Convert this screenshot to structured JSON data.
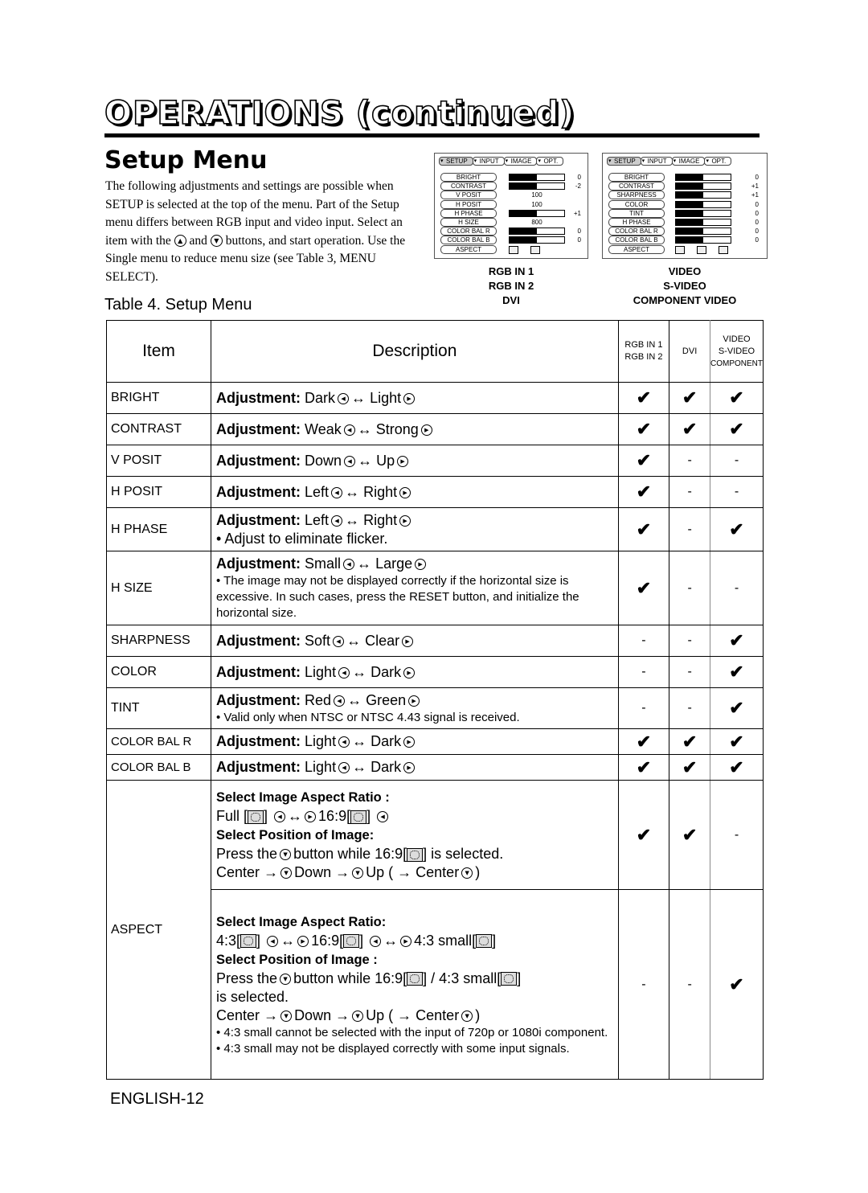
{
  "header": {
    "section_title": "OPERATIONS (continued)",
    "page_title": "Setup Menu",
    "intro_parts": [
      "The following adjustments and settings are possible when SETUP is selected at the top of the menu. Part of the Setup menu differs between RGB input and video input. Select an item with the ",
      " and ",
      " buttons, and start operation. Use the Single menu to reduce menu size (see Table 3, MENU SELECT)."
    ]
  },
  "icons": {
    "up": "▲",
    "down": "▼",
    "left": "◀",
    "right": "▶",
    "swap": "↔",
    "to": "→",
    "check": "✔"
  },
  "osd_rgb": {
    "tabs": [
      "SETUP",
      "INPUT",
      "IMAGE",
      "OPT."
    ],
    "active_tab": "SETUP",
    "rows": [
      {
        "label": "BRIGHT",
        "type": "bar",
        "level": 0.5,
        "value": "0"
      },
      {
        "label": "CONTRAST",
        "type": "bar",
        "level": 0.5,
        "value": "-2"
      },
      {
        "label": "V POSIT",
        "type": "number",
        "value": "100"
      },
      {
        "label": "H POSIT",
        "type": "number",
        "value": "100"
      },
      {
        "label": "H PHASE",
        "type": "bar",
        "level": 0.5,
        "value": "+1"
      },
      {
        "label": "H SIZE",
        "type": "number",
        "value": "800"
      },
      {
        "label": "COLOR BAL R",
        "type": "bar",
        "level": 0.5,
        "value": "0"
      },
      {
        "label": "COLOR BAL B",
        "type": "bar",
        "level": 0.5,
        "value": "0"
      },
      {
        "label": "ASPECT",
        "type": "icons",
        "count": 2
      }
    ],
    "caption": [
      "RGB IN 1",
      "RGB IN 2",
      "DVI"
    ]
  },
  "osd_video": {
    "tabs": [
      "SETUP",
      "INPUT",
      "IMAGE",
      "OPT."
    ],
    "active_tab": "SETUP",
    "rows": [
      {
        "label": "BRIGHT",
        "type": "bar",
        "level": 0.5,
        "value": "0"
      },
      {
        "label": "CONTRAST",
        "type": "bar",
        "level": 0.5,
        "value": "+1"
      },
      {
        "label": "SHARPNESS",
        "type": "bar",
        "level": 0.5,
        "value": "+1"
      },
      {
        "label": "COLOR",
        "type": "bar",
        "level": 0.5,
        "value": "0"
      },
      {
        "label": "TINT",
        "type": "bar",
        "level": 0.5,
        "value": "0"
      },
      {
        "label": "H PHASE",
        "type": "bar",
        "level": 0.5,
        "value": "0"
      },
      {
        "label": "COLOR BAL  R",
        "type": "bar",
        "level": 0.5,
        "value": "0"
      },
      {
        "label": "COLOR BAL  B",
        "type": "bar",
        "level": 0.5,
        "value": "0"
      },
      {
        "label": "ASPECT",
        "type": "icons",
        "count": 3
      }
    ],
    "caption": [
      "VIDEO",
      "S-VIDEO",
      "COMPONENT VIDEO"
    ]
  },
  "table": {
    "title": "Table 4. Setup Menu",
    "headers": {
      "item": "Item",
      "description": "Description",
      "col_rgb": [
        "RGB IN 1",
        "RGB IN 2"
      ],
      "col_dvi": "DVI",
      "col_video": [
        "VIDEO",
        "S-VIDEO",
        "COMPONENT"
      ]
    },
    "adjust_label": "Adjustment:",
    "rows": [
      {
        "item": "BRIGHT",
        "left": "Dark",
        "right": "Light",
        "notes": [],
        "rgb": "check",
        "dvi": "check",
        "video": "check"
      },
      {
        "item": "CONTRAST",
        "left": "Weak",
        "right": "Strong",
        "notes": [],
        "rgb": "check",
        "dvi": "check",
        "video": "check"
      },
      {
        "item": "V POSIT",
        "left": "Down",
        "right": "Up",
        "notes": [],
        "rgb": "check",
        "dvi": "-",
        "video": "-"
      },
      {
        "item": "H POSIT",
        "left": "Left",
        "right": "Right",
        "notes": [],
        "rgb": "check",
        "dvi": "-",
        "video": "-"
      },
      {
        "item": "H PHASE",
        "left": "Left",
        "right": "Right",
        "notes": [
          "• Adjust to eliminate flicker."
        ],
        "note_large": true,
        "rgb": "check",
        "dvi": "-",
        "video": "check"
      },
      {
        "item": "H SIZE",
        "left": "Small",
        "right": "Large",
        "notes": [
          "• The image may not be displayed correctly if the horizontal size is excessive. In such cases, press the RESET button, and initialize the horizontal size."
        ],
        "rgb": "check",
        "dvi": "-",
        "video": "-"
      },
      {
        "item": "SHARPNESS",
        "left": "Soft",
        "right": "Clear",
        "notes": [],
        "rgb": "-",
        "dvi": "-",
        "video": "check"
      },
      {
        "item": "COLOR",
        "left": "Light",
        "right": "Dark",
        "notes": [],
        "rgb": "-",
        "dvi": "-",
        "video": "check"
      },
      {
        "item": "TINT",
        "left": "Red",
        "right": "Green",
        "notes": [
          "• Valid only when NTSC or NTSC 4.43 signal is received."
        ],
        "rgb": "-",
        "dvi": "-",
        "video": "check"
      },
      {
        "item": "COLOR BAL R",
        "left": "Light",
        "right": "Dark",
        "notes": [],
        "rgb": "check",
        "dvi": "check",
        "video": "check"
      },
      {
        "item": "COLOR BAL B",
        "left": "Light",
        "right": "Dark",
        "notes": [],
        "rgb": "check",
        "dvi": "check",
        "video": "check"
      }
    ],
    "aspect": {
      "item": "ASPECT",
      "rgb_block": {
        "ratio_heading": "Select Image Aspect Ratio :",
        "full_label": "Full [",
        "ratio169_label": "16:9[",
        "position_heading": "Select Position of Image:",
        "press_the": "Press the",
        "button_while": "button while 16:9[",
        "is_selected": "] is selected.",
        "center": "Center",
        "down": "Down",
        "up": "Up (",
        "center_end": "Center",
        "rgb": "check",
        "dvi": "check",
        "video": "-"
      },
      "video_block": {
        "ratio_heading": "Select Image Aspect Ratio:",
        "r43": "4:3[",
        "r169": "16:9[",
        "r43small": "4:3 small[",
        "position_heading": "Select Position of Image :",
        "press_the": "Press the",
        "button_while": "button while 16:9[",
        "slash_small": "] / 4:3 small[",
        "is_selected": "is selected.",
        "center": "Center",
        "down": "Down",
        "up": "Up (",
        "center_end": "Center",
        "notes": [
          "• 4:3 small cannot be selected with the input of 720p or 1080i component.",
          "• 4:3 small may not be displayed correctly with some input signals."
        ],
        "rgb": "-",
        "dvi": "-",
        "video": "check"
      }
    }
  },
  "footer": {
    "page": "ENGLISH-12"
  }
}
